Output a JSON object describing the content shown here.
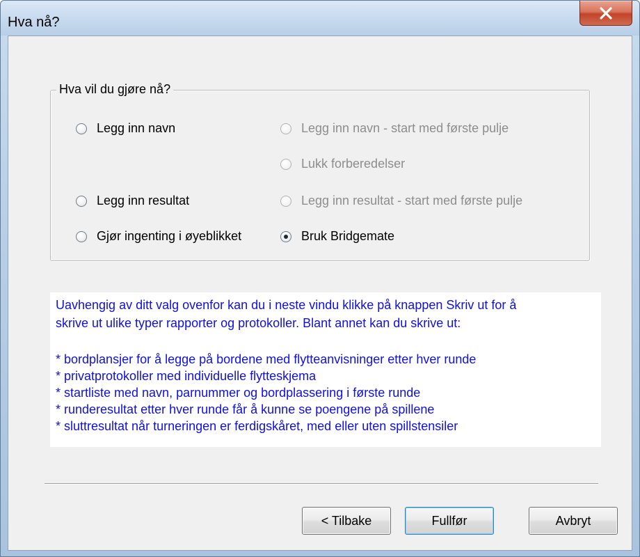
{
  "window": {
    "title": "Hva nå?",
    "close_glyph": "X"
  },
  "group": {
    "legend": "Hva vil du gjøre nå?",
    "options": [
      {
        "label": "Legg inn navn",
        "checked": false,
        "enabled": true
      },
      {
        "label": "Legg inn navn - start med første pulje",
        "checked": false,
        "enabled": false
      },
      {
        "label": "Lukk forberedelser",
        "checked": false,
        "enabled": false
      },
      {
        "label": "Legg inn resultat",
        "checked": false,
        "enabled": true
      },
      {
        "label": "Legg inn resultat - start med første pulje",
        "checked": false,
        "enabled": false
      },
      {
        "label": "Gjør ingenting i øyeblikket",
        "checked": false,
        "enabled": true
      },
      {
        "label": "Bruk Bridgemate",
        "checked": true,
        "enabled": true
      }
    ]
  },
  "info": {
    "intro_lines": [
      "Uavhengig av ditt valg ovenfor kan du i neste vindu klikke på knappen Skriv ut for å",
      "skrive ut ulike typer rapporter og protokoller. Blant annet kan du skrive ut:"
    ],
    "bullets": [
      "* bordplansjer for å legge på bordene med flytteanvisninger etter hver runde",
      "* privatprotokoller med individuelle flytteskjema",
      "* startliste med navn, parnummer og bordplassering i første runde",
      "* runderesultat etter hver runde får å kunne se poengene på spillene",
      "* sluttresultat når turneringen er ferdigskåret, med eller uten spillstensiler"
    ]
  },
  "buttons": {
    "back": "< Tilbake",
    "finish": "Fullfør",
    "cancel": "Avbryt"
  },
  "colors": {
    "info_text": "#1010e0",
    "disabled_text": "#8d8d8d",
    "close_button": "#c2442a"
  }
}
